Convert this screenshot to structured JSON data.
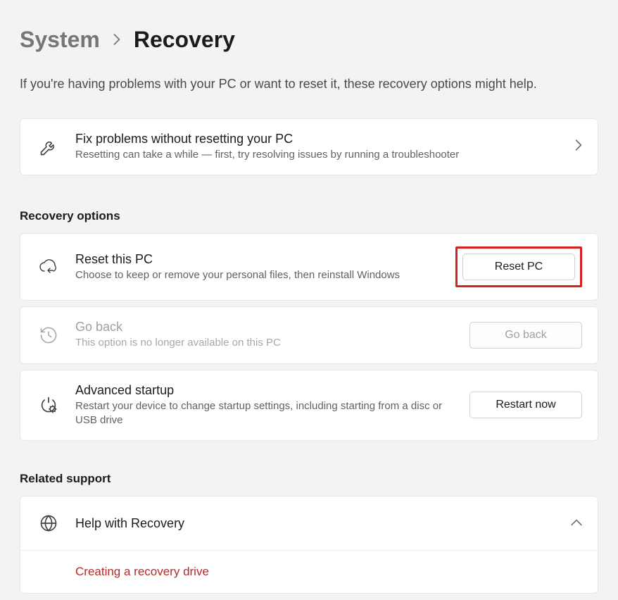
{
  "breadcrumb": {
    "parent": "System",
    "current": "Recovery"
  },
  "subtitle": "If you're having problems with your PC or want to reset it, these recovery options might help.",
  "fix_card": {
    "title": "Fix problems without resetting your PC",
    "desc": "Resetting can take a while — first, try resolving issues by running a troubleshooter"
  },
  "sections": {
    "recovery_options": "Recovery options",
    "related_support": "Related support"
  },
  "reset_card": {
    "title": "Reset this PC",
    "desc": "Choose to keep or remove your personal files, then reinstall Windows",
    "button": "Reset PC"
  },
  "goback_card": {
    "title": "Go back",
    "desc": "This option is no longer available on this PC",
    "button": "Go back"
  },
  "advanced_card": {
    "title": "Advanced startup",
    "desc": "Restart your device to change startup settings, including starting from a disc or USB drive",
    "button": "Restart now"
  },
  "help_expand": {
    "title": "Help with Recovery",
    "link": "Creating a recovery drive"
  }
}
